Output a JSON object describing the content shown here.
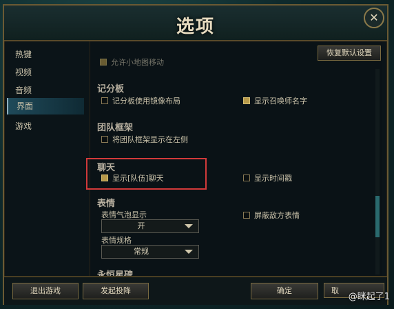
{
  "window": {
    "title": "选项",
    "close_symbol": "✕"
  },
  "sidebar": {
    "items": [
      {
        "label": "热键"
      },
      {
        "label": "视频"
      },
      {
        "label": "音频"
      },
      {
        "label": "界面"
      },
      {
        "label": "游戏"
      }
    ],
    "active_index": 3
  },
  "content": {
    "reset_button": "恢复默认设置",
    "partial_option": "允许小地图移动",
    "scoreboard": {
      "title": "记分板",
      "options": [
        {
          "label": "记分板使用镜像布局",
          "checked": false
        },
        {
          "label": "显示召唤师名字",
          "checked": true
        }
      ]
    },
    "team_frames": {
      "title": "团队框架",
      "options": [
        {
          "label": "将团队框架显示在左侧",
          "checked": false
        }
      ]
    },
    "chat": {
      "title": "聊天",
      "options": [
        {
          "label": "显示[队伍]聊天",
          "checked": true
        },
        {
          "label": "显示时间戳",
          "checked": false
        }
      ]
    },
    "emotes": {
      "title": "表情",
      "bubble_label": "表情气泡显示",
      "bubble_value": "开",
      "mute_enemy": {
        "label": "屏蔽敌方表情",
        "checked": false
      },
      "size_label": "表情规格",
      "size_value": "常规"
    },
    "partial_section": "永恒星碑"
  },
  "bottom": {
    "exit_game": "退出游戏",
    "surrender": "发起投降",
    "confirm": "确定",
    "cancel_partial": "取"
  },
  "watermark": "@眯起了1",
  "colors": {
    "gold_border": "#6b5a33",
    "checkbox_on": "#b89a4a",
    "highlight_box": "#d23a3a"
  }
}
